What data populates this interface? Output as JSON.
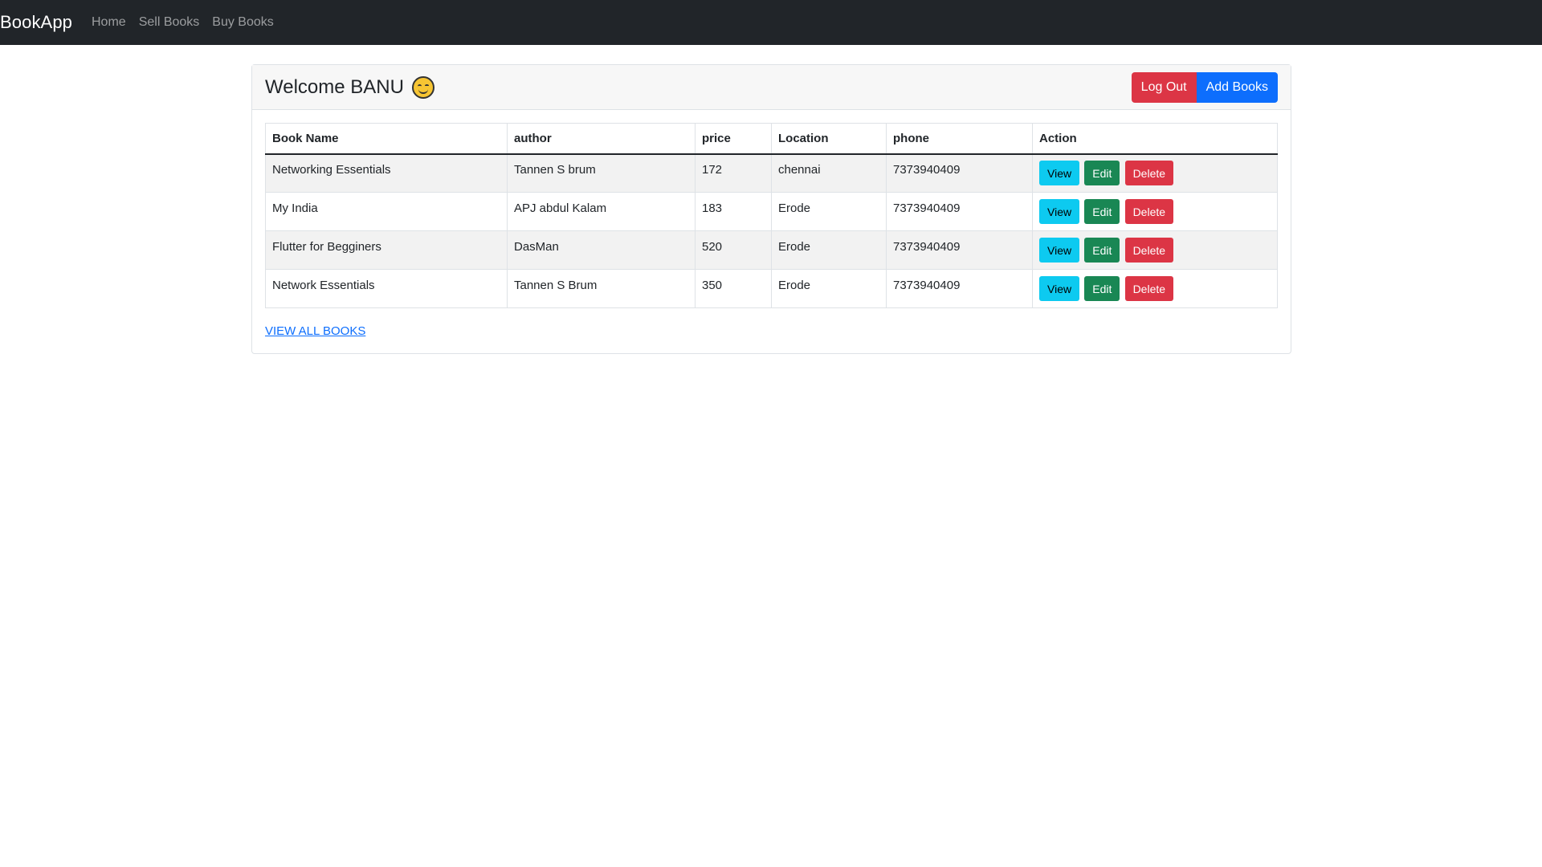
{
  "navbar": {
    "brand": "BookApp",
    "links": [
      "Home",
      "Sell Books",
      "Buy Books"
    ]
  },
  "header": {
    "welcome": "Welcome BANU",
    "logout_label": "Log Out",
    "add_books_label": "Add Books"
  },
  "table": {
    "columns": [
      "Book Name",
      "author",
      "price",
      "Location",
      "phone",
      "Action"
    ],
    "rows": [
      {
        "name": "Networking Essentials",
        "author": "Tannen S brum",
        "price": "172",
        "location": "chennai",
        "phone": "7373940409"
      },
      {
        "name": "My India",
        "author": "APJ abdul Kalam",
        "price": "183",
        "location": "Erode",
        "phone": "7373940409"
      },
      {
        "name": "Flutter for Begginers",
        "author": "DasMan",
        "price": "520",
        "location": "Erode",
        "phone": "7373940409"
      },
      {
        "name": "Network Essentials",
        "author": "Tannen S Brum",
        "price": "350",
        "location": "Erode",
        "phone": "7373940409"
      }
    ],
    "actions": {
      "view": "View",
      "edit": "Edit",
      "delete": "Delete"
    }
  },
  "footer_link": "VIEW ALL BOOKS",
  "colors": {
    "navbar_bg": "#212529",
    "danger": "#dc3545",
    "primary": "#0d6efd",
    "info": "#0dcaf0",
    "success": "#198754"
  }
}
